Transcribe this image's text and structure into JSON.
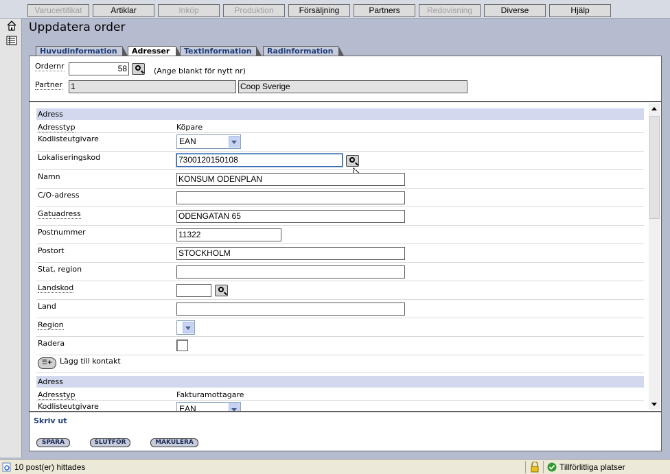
{
  "menu": [
    "Varucertifikat",
    "Artiklar",
    "Inköp",
    "Produktion",
    "Försäljning",
    "Partners",
    "Redovisning",
    "Diverse",
    "Hjälp"
  ],
  "page_title": "Uppdatera order",
  "tabs": [
    "Huvudinformation",
    "Adresser",
    "Textinformation",
    "Radinformation"
  ],
  "header": {
    "ordernr_label": "Ordernr",
    "ordernr_value": "58",
    "ordernr_hint": "(Ange blankt för nytt nr)",
    "partner_label": "Partner",
    "partner_id": "1",
    "partner_name": "Coop Sverige"
  },
  "address1": {
    "section": "Adress",
    "adresstyp_label": "Adresstyp",
    "adresstyp_value": "Köpare",
    "kodlisteutgivare_label": "Kodlisteutgivare",
    "kodlisteutgivare_value": "EAN",
    "lokaliseringskod_label": "Lokaliseringskod",
    "lokaliseringskod_value": "7300120150108",
    "namn_label": "Namn",
    "namn_value": "KONSUM ODENPLAN",
    "co_label": "C/O-adress",
    "co_value": "",
    "gatuadress_label": "Gatuadress",
    "gatuadress_value": "ODENGATAN 65",
    "postnummer_label": "Postnummer",
    "postnummer_value": "11322",
    "postort_label": "Postort",
    "postort_value": "STOCKHOLM",
    "stat_label": "Stat, region",
    "stat_value": "",
    "landskod_label": "Landskod",
    "landskod_value": "",
    "land_label": "Land",
    "land_value": "",
    "region_label": "Region",
    "region_value": "",
    "radera_label": "Radera",
    "add_contact_label": "Lägg till kontakt"
  },
  "address2": {
    "section": "Adress",
    "adresstyp_label": "Adresstyp",
    "adresstyp_value": "Fakturamottagare",
    "kodlisteutgivare_label": "Kodlisteutgivare",
    "kodlisteutgivare_value": "EAN"
  },
  "footer": {
    "print_label": "Skriv ut",
    "save": "SPARA",
    "finish": "SLUTFÖR",
    "cancel": "MAKULERA"
  },
  "statusbar": {
    "left_text": "10 post(er) hittades",
    "zone_text": "Tillförlitliga platser"
  },
  "colors": {
    "background": "#b6bccf",
    "section_header": "#d2d9ee",
    "tab_text": "#1f3d7a"
  },
  "icons": [
    "home-icon",
    "list-icon",
    "magnifier-icon",
    "add-contact-icon",
    "lock-icon",
    "trusted-check-icon",
    "ie-page-icon"
  ]
}
